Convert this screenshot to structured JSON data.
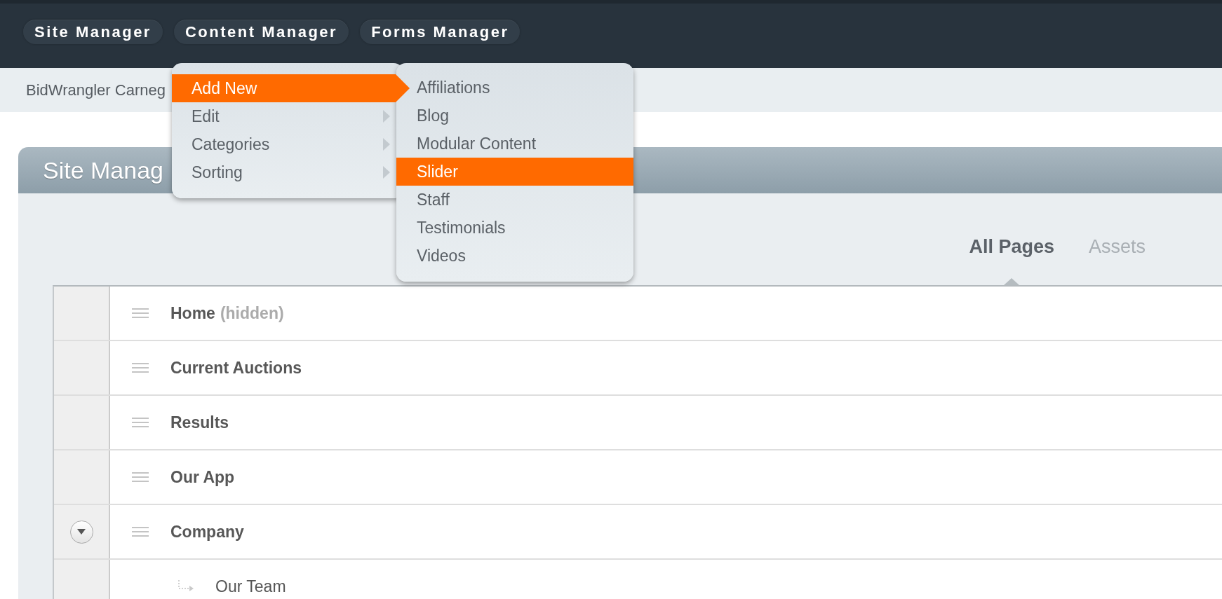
{
  "nav": [
    {
      "label": "Site Manager"
    },
    {
      "label": "Content Manager"
    },
    {
      "label": "Forms Manager"
    }
  ],
  "menu": {
    "items": [
      {
        "label": "Add New",
        "selected": true
      },
      {
        "label": "Edit",
        "selected": false
      },
      {
        "label": "Categories",
        "selected": false
      },
      {
        "label": "Sorting",
        "selected": false
      }
    ],
    "submenu": {
      "items": [
        {
          "label": "Affiliations",
          "selected": false
        },
        {
          "label": "Blog",
          "selected": false
        },
        {
          "label": "Modular Content",
          "selected": false
        },
        {
          "label": "Slider",
          "selected": true
        },
        {
          "label": "Staff",
          "selected": false
        },
        {
          "label": "Testimonials",
          "selected": false
        },
        {
          "label": "Videos",
          "selected": false
        }
      ]
    }
  },
  "breadcrumb": "BidWrangler Carneg",
  "panel": {
    "title": "Site Manag",
    "tabs": [
      {
        "label": "All Pages",
        "selected": true
      },
      {
        "label": "Assets",
        "selected": false
      }
    ],
    "rows": [
      {
        "name": "Home",
        "note": "(hidden)"
      },
      {
        "name": "Current Auctions"
      },
      {
        "name": "Results"
      },
      {
        "name": "Our App"
      },
      {
        "name": "Company",
        "expanded": true,
        "children": [
          {
            "name": "Our Team"
          }
        ]
      }
    ]
  }
}
